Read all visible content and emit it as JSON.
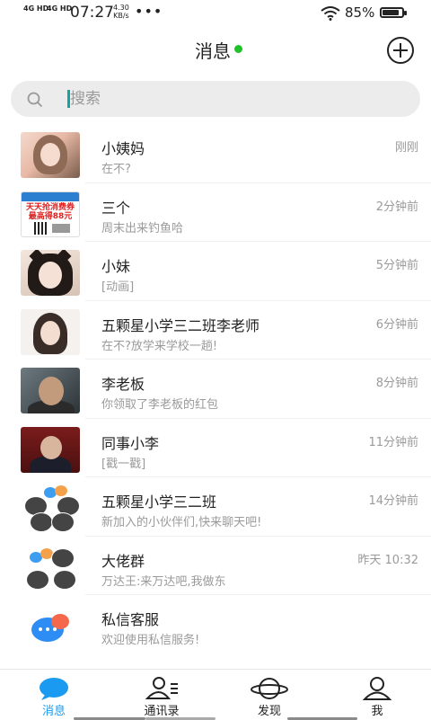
{
  "status_bar": {
    "network1": "4G HD",
    "network2": "4G HD",
    "time": "07:27",
    "speed_value": "4.30",
    "speed_unit": "KB/s",
    "more": "•••",
    "battery_percent": "85%",
    "battery_level": 0.85
  },
  "header": {
    "title": "消息",
    "online_color": "#21c12a"
  },
  "search": {
    "placeholder": "搜索"
  },
  "conversations": [
    {
      "name": "小姨妈",
      "preview": "在不?",
      "time": "刚刚"
    },
    {
      "name": "三个",
      "preview": "周末出来钓鱼哈",
      "time": "2分钟前",
      "avatar_text": [
        "天天抢消费券",
        "最高得88元"
      ]
    },
    {
      "name": "小妹",
      "preview": "[动画]",
      "time": "5分钟前"
    },
    {
      "name": "五颗星小学三二班李老师",
      "preview": "在不?放学来学校一趟!",
      "time": "6分钟前"
    },
    {
      "name": "李老板",
      "preview": "你领取了李老板的红包",
      "time": "8分钟前"
    },
    {
      "name": "同事小李",
      "preview": "[戳一戳]",
      "time": "11分钟前"
    },
    {
      "name": "五颗星小学三二班",
      "preview": "新加入的小伙伴们,快来聊天吧!",
      "time": "14分钟前"
    },
    {
      "name": "大佬群",
      "preview": "万达王:来万达吧,我做东",
      "time": "昨天 10:32"
    },
    {
      "name": "私信客服",
      "preview": "欢迎使用私信服务!",
      "time": ""
    }
  ],
  "bottom_nav": [
    {
      "label": "消息",
      "icon": "chat-bubble-icon",
      "active": true
    },
    {
      "label": "通讯录",
      "icon": "contacts-icon",
      "active": false
    },
    {
      "label": "发现",
      "icon": "planet-icon",
      "active": false
    },
    {
      "label": "我",
      "icon": "person-icon",
      "active": false
    }
  ],
  "colors": {
    "accent": "#1a9af0",
    "cursor": "#16a2a0",
    "muted": "#9a9a9a"
  }
}
